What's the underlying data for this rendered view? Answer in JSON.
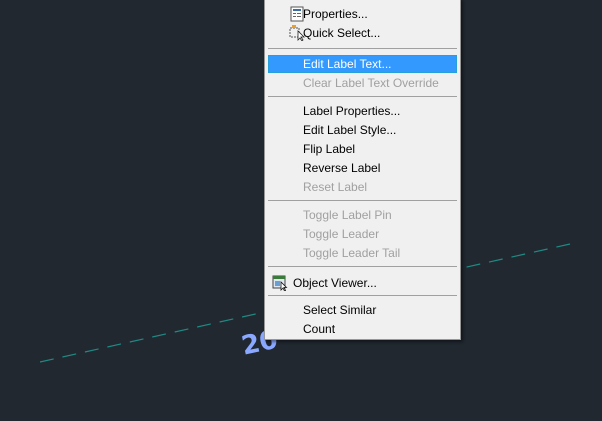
{
  "drawing": {
    "label_text": "20",
    "line_color": "#1f8a84",
    "label_color": "#8aa8ff"
  },
  "menu": {
    "items": [
      {
        "label": "Properties...",
        "enabled": true,
        "icon": "properties-icon"
      },
      {
        "label": "Quick Select...",
        "enabled": true,
        "icon": "quick-select-icon"
      },
      {
        "label": "Edit Label Text...",
        "enabled": true,
        "highlighted": true
      },
      {
        "label": "Clear Label Text Override",
        "enabled": false
      },
      {
        "label": "Label Properties...",
        "enabled": true
      },
      {
        "label": "Edit Label Style...",
        "enabled": true
      },
      {
        "label": "Flip Label",
        "enabled": true
      },
      {
        "label": "Reverse Label",
        "enabled": true
      },
      {
        "label": "Reset Label",
        "enabled": false
      },
      {
        "label": "Toggle Label Pin",
        "enabled": false
      },
      {
        "label": "Toggle Leader",
        "enabled": false
      },
      {
        "label": "Toggle Leader Tail",
        "enabled": false
      },
      {
        "label": "Object Viewer...",
        "enabled": true,
        "icon": "object-viewer-icon"
      },
      {
        "label": "Select Similar",
        "enabled": true
      },
      {
        "label": "Count",
        "enabled": true
      }
    ],
    "highlight_color": "#3399ff"
  }
}
